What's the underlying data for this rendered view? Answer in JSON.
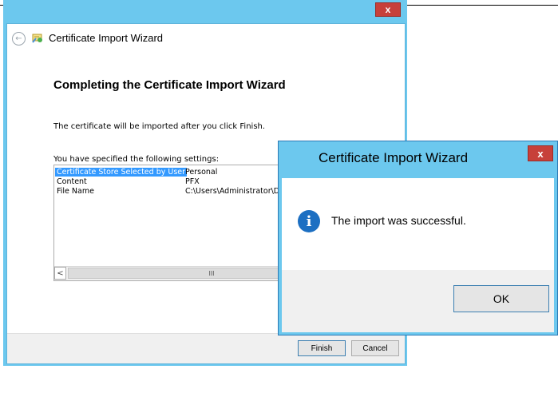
{
  "wizard": {
    "title": "Certificate Import Wizard",
    "close_glyph": "x",
    "back_glyph": "←",
    "heading": "Completing the Certificate Import Wizard",
    "info_text": "The certificate will be imported after you click Finish.",
    "settings_label": "You have specified the following settings:",
    "settings": [
      {
        "key": "Certificate Store Selected by User",
        "value": "Personal",
        "selected": true
      },
      {
        "key": "Content",
        "value": "PFX",
        "selected": false
      },
      {
        "key": "File Name",
        "value": "C:\\Users\\Administrator\\D",
        "selected": false
      }
    ],
    "scroll_left_glyph": "<",
    "scroll_thumb_glyph": "III",
    "finish_label": "Finish",
    "cancel_label": "Cancel"
  },
  "message_box": {
    "title": "Certificate Import Wizard",
    "close_glyph": "x",
    "icon_glyph": "i",
    "message": "The import was successful.",
    "ok_label": "OK"
  },
  "colors": {
    "title_bar": "#6cc8ee",
    "close_button": "#c7403a",
    "selection": "#3399ff",
    "info_icon": "#1c6fc2"
  },
  "icons": {
    "back": "back-arrow-icon",
    "certificate": "certificate-icon",
    "info": "info-icon",
    "close": "close-icon"
  }
}
